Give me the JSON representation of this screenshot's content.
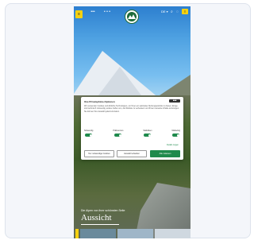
{
  "header": {
    "logo_badge": "≡",
    "nav_items": [
      "•••",
      "• • •"
    ],
    "language": "DE ▾",
    "icons": [
      "search-icon",
      "account-icon"
    ],
    "icon_glyphs": [
      "⌕",
      "◌"
    ],
    "action_label": "≡"
  },
  "cookie_dialog": {
    "title": "Ihre Privatsphäre-Optionen",
    "brand_badge": "■■■",
    "body": "Wir verwenden Cookies und ähnliche Technologien, um Ihnen ein optimales Nutzungserlebnis zu bieten. Einige sind technisch notwendig, andere helfen uns, die Website zu verbessern und Ihnen relevante Inhalte anzuzeigen. Sie können Ihre Auswahl jederzeit ändern.",
    "toggles": [
      {
        "label": "Notwendig",
        "on": true
      },
      {
        "label": "Präferenzen",
        "on": true
      },
      {
        "label": "Statistiken",
        "on": true
      },
      {
        "label": "Marketing",
        "on": true
      }
    ],
    "details_link": "Details zeigen",
    "buttons": {
      "deny": "Nur notwendige Cookies",
      "save": "Auswahl erlauben",
      "accept": "Alle zulassen"
    }
  },
  "hero": {
    "subtitle": "Die Alpen von ihrer schönsten Seite",
    "title": "Aussicht"
  },
  "colors": {
    "accent": "#1f8a4c",
    "badge": "#f5d110"
  }
}
